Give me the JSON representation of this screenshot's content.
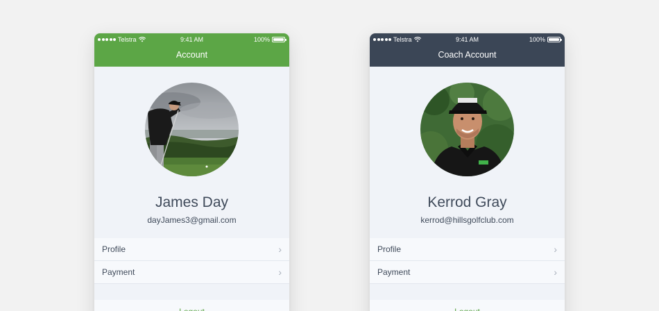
{
  "screens": [
    {
      "status": {
        "carrier": "Telstra",
        "time": "9:41 AM",
        "battery": "100%"
      },
      "header_title": "Account",
      "header_color": "#5ca646",
      "name": "James Day",
      "email": "dayJames3@gmail.com",
      "menu": [
        {
          "label": "Profile"
        },
        {
          "label": "Payment"
        }
      ],
      "logout": "Logout"
    },
    {
      "status": {
        "carrier": "Telstra",
        "time": "9:41 AM",
        "battery": "100%"
      },
      "header_title": "Coach Account",
      "header_color": "#3b4656",
      "name": "Kerrod Gray",
      "email": "kerrod@hillsgolfclub.com",
      "menu": [
        {
          "label": "Profile"
        },
        {
          "label": "Payment"
        }
      ],
      "logout": "Logout"
    }
  ],
  "icons": {
    "signal": "signal-dots-icon",
    "wifi": "wifi-icon",
    "battery": "battery-icon",
    "chevron": "chevron-right-icon"
  },
  "colors": {
    "accent_green": "#5ca646",
    "coach_header": "#3b4656",
    "text": "#3f4a5a"
  }
}
